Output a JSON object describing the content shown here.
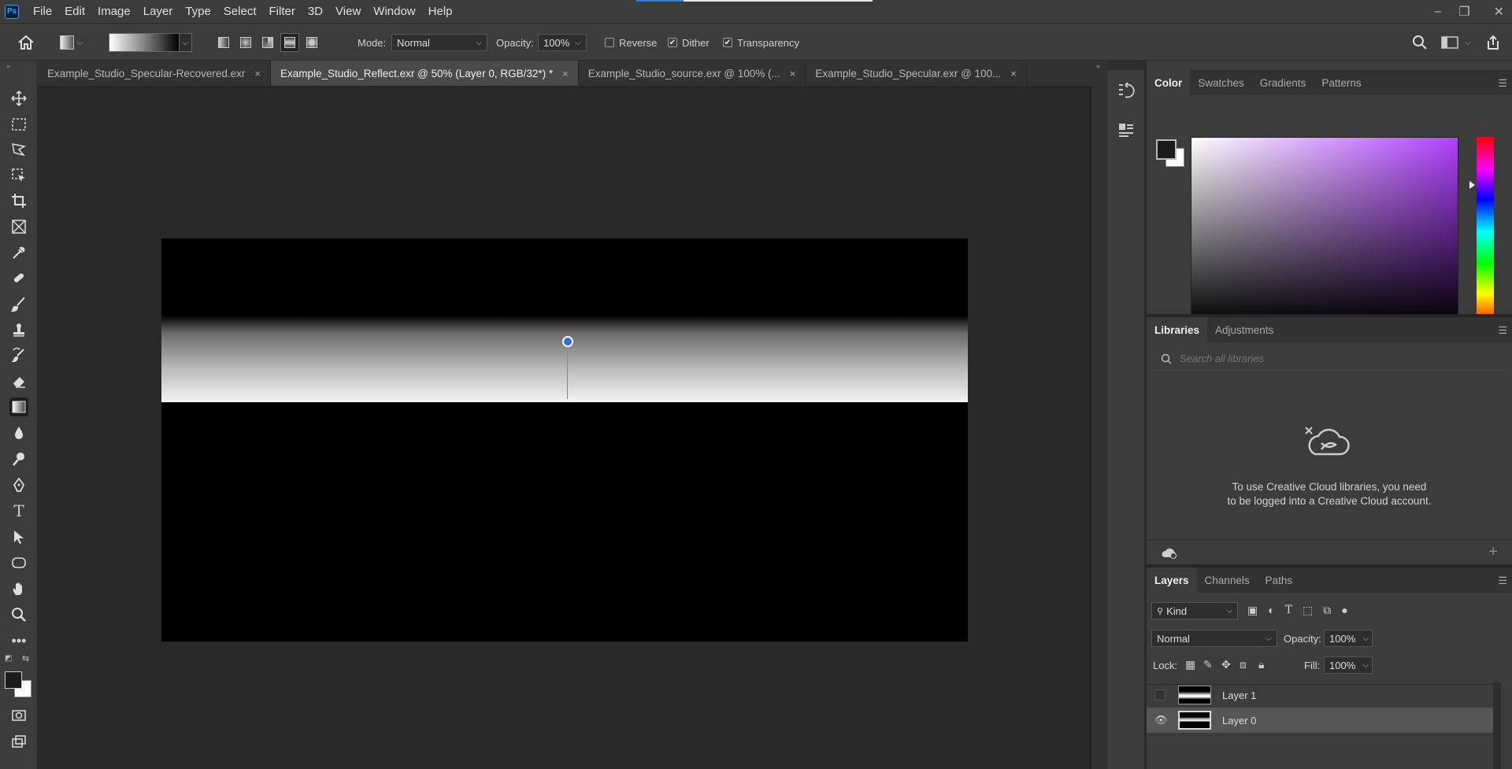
{
  "app": {
    "logo": "Ps"
  },
  "menu": [
    "File",
    "Edit",
    "Image",
    "Layer",
    "Type",
    "Select",
    "Filter",
    "3D",
    "View",
    "Window",
    "Help"
  ],
  "window_controls": {
    "minimize": "–",
    "restore": "❐",
    "close": "✕"
  },
  "options": {
    "mode_label": "Mode:",
    "mode_value": "Normal",
    "opacity_label": "Opacity:",
    "opacity_value": "100%",
    "reverse_label": "Reverse",
    "reverse_checked": false,
    "dither_label": "Dither",
    "dither_checked": true,
    "transparency_label": "Transparency",
    "transparency_checked": true
  },
  "tabs": [
    {
      "label": "Example_Studio_Specular-Recovered.exr",
      "active": false
    },
    {
      "label": "Example_Studio_Reflect.exr @ 50% (Layer 0, RGB/32*) *",
      "active": true
    },
    {
      "label": "Example_Studio_source.exr @ 100% (...",
      "active": false
    },
    {
      "label": "Example_Studio_Specular.exr @ 100...",
      "active": false
    }
  ],
  "tab_close": "×",
  "color_panel": {
    "tabs": [
      "Color",
      "Swatches",
      "Gradients",
      "Patterns"
    ],
    "foreground": "#1b1b1b",
    "background": "#ffffff",
    "field_hue": "#b040ff"
  },
  "libraries_panel": {
    "tabs": [
      "Libraries",
      "Adjustments"
    ],
    "search_placeholder": "Search all libraries",
    "message": "To use Creative Cloud libraries, you need to be logged into a Creative Cloud account."
  },
  "layers_panel": {
    "tabs": [
      "Layers",
      "Channels",
      "Paths"
    ],
    "filter_label": "Kind",
    "blend_mode": "Normal",
    "opacity_label": "Opacity:",
    "opacity_value": "100%",
    "lock_label": "Lock:",
    "fill_label": "Fill:",
    "fill_value": "100%",
    "layers": [
      {
        "name": "Layer 1",
        "visible": false,
        "selected": false
      },
      {
        "name": "Layer 0",
        "visible": true,
        "selected": true
      }
    ]
  },
  "colors": {
    "accent": "#2f6de0",
    "panel": "#3c3c3c",
    "canvas_bg": "#282828"
  }
}
